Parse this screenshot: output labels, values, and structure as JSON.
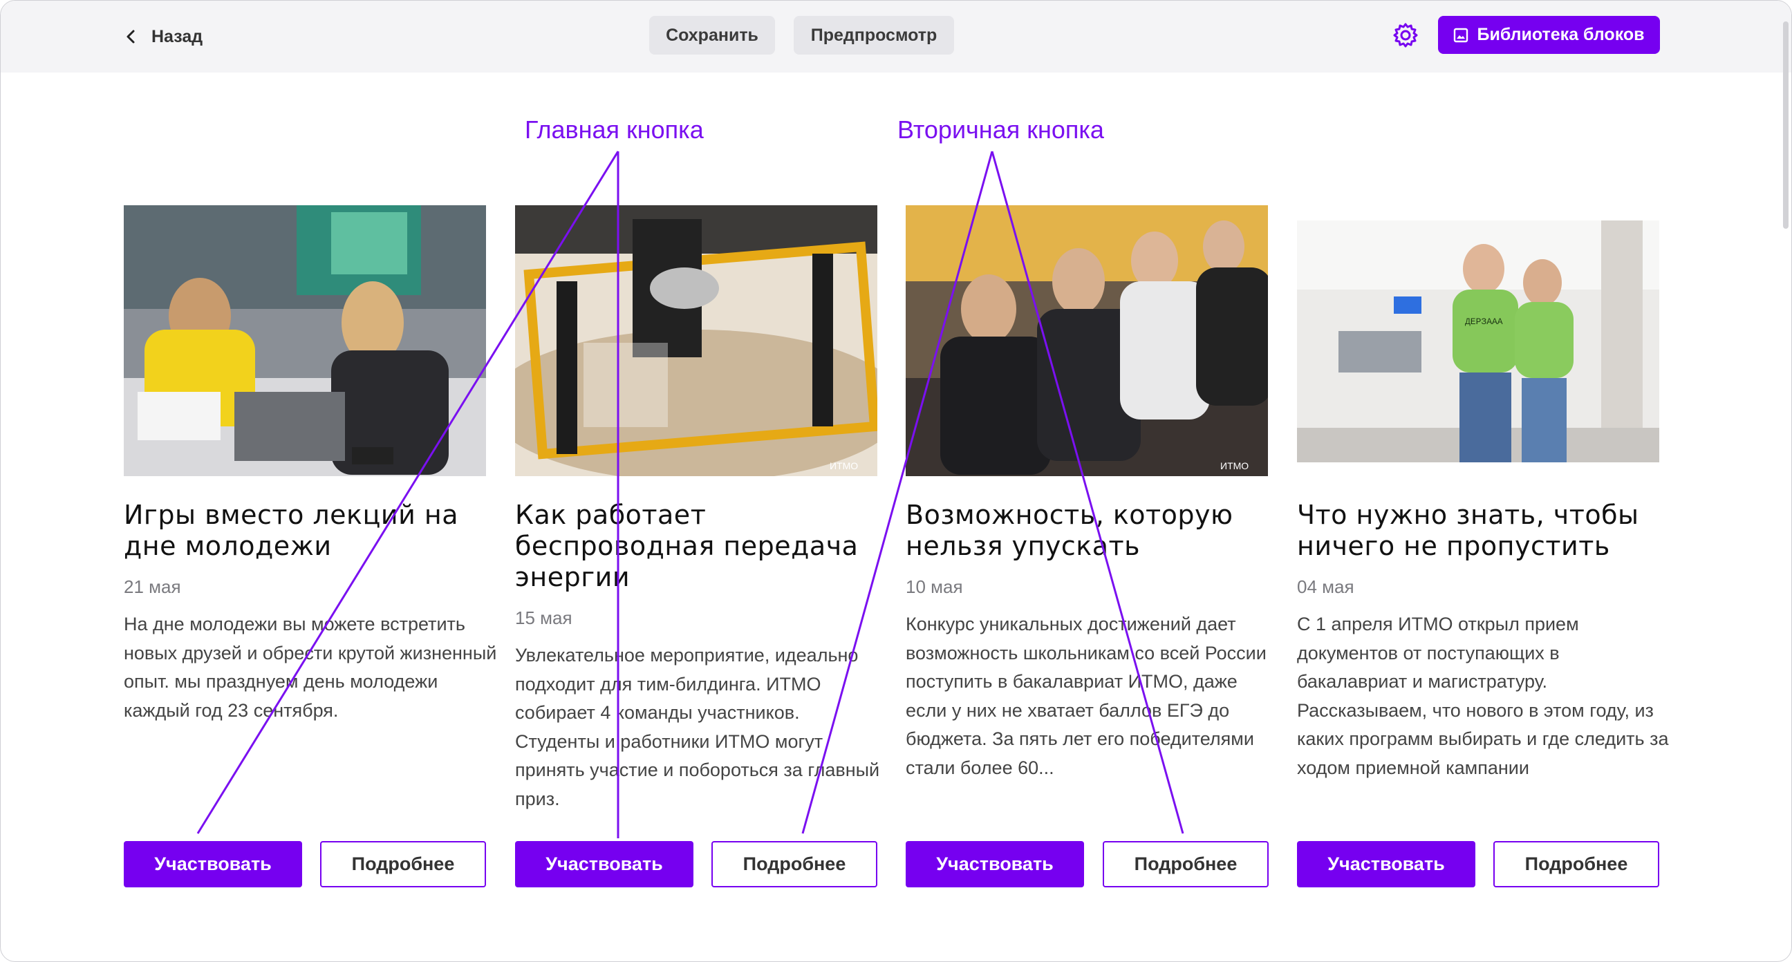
{
  "topbar": {
    "back_label": "Назад",
    "save_label": "Сохранить",
    "preview_label": "Предпросмотр",
    "library_label": "Библиотека блоков"
  },
  "annotations": {
    "primary": "Главная кнопка",
    "secondary": "Вторичная кнопка"
  },
  "colors": {
    "accent": "#7600f0",
    "annotation": "#7a10f0"
  },
  "cards": [
    {
      "title": "Игры вместо лекций на дне молодежи",
      "date": "21 мая",
      "description": "На дне молодежи вы можете встретить новых друзей и обрести крутой жизненный опыт. мы празднуем день молодежи каждый год 23 сентября.",
      "primary_label": "Участвовать",
      "secondary_label": "Подробнее"
    },
    {
      "title": "Как работает беспроводная передача энергии",
      "date": "15 мая",
      "description": "Увлекательное мероприятие, идеально подходит для тим-билдинга. ИТМО собирает 4 команды участников. Студенты и работники ИТМО могут принять участие и побороться за главный приз.",
      "primary_label": "Участвовать",
      "secondary_label": "Подробнее",
      "image_watermark": "ИТМО"
    },
    {
      "title": "Возможность, которую нельзя упускать",
      "date": "10 мая",
      "description": "Конкурс уникальных достижений дает возможность школьникам со всей России поступить в бакалавриат ИТМО, даже если у них не хватает баллов ЕГЭ до бюджета. За пять лет его победителями стали более 60...",
      "primary_label": "Участвовать",
      "secondary_label": "Подробнее",
      "image_watermark": "ИТМО"
    },
    {
      "title": "Что нужно знать, чтобы ничего не пропустить",
      "date": "04 мая",
      "description": "С 1 апреля ИТМО открыл прием документов от поступающих в бакалавриат и магистратуру. Рассказываем, что нового в этом году, из каких программ выбирать и где следить за ходом приемной кампании",
      "primary_label": "Участвовать",
      "secondary_label": "Подробнее",
      "image_shirt_text": "ДЕРЗААА"
    }
  ]
}
